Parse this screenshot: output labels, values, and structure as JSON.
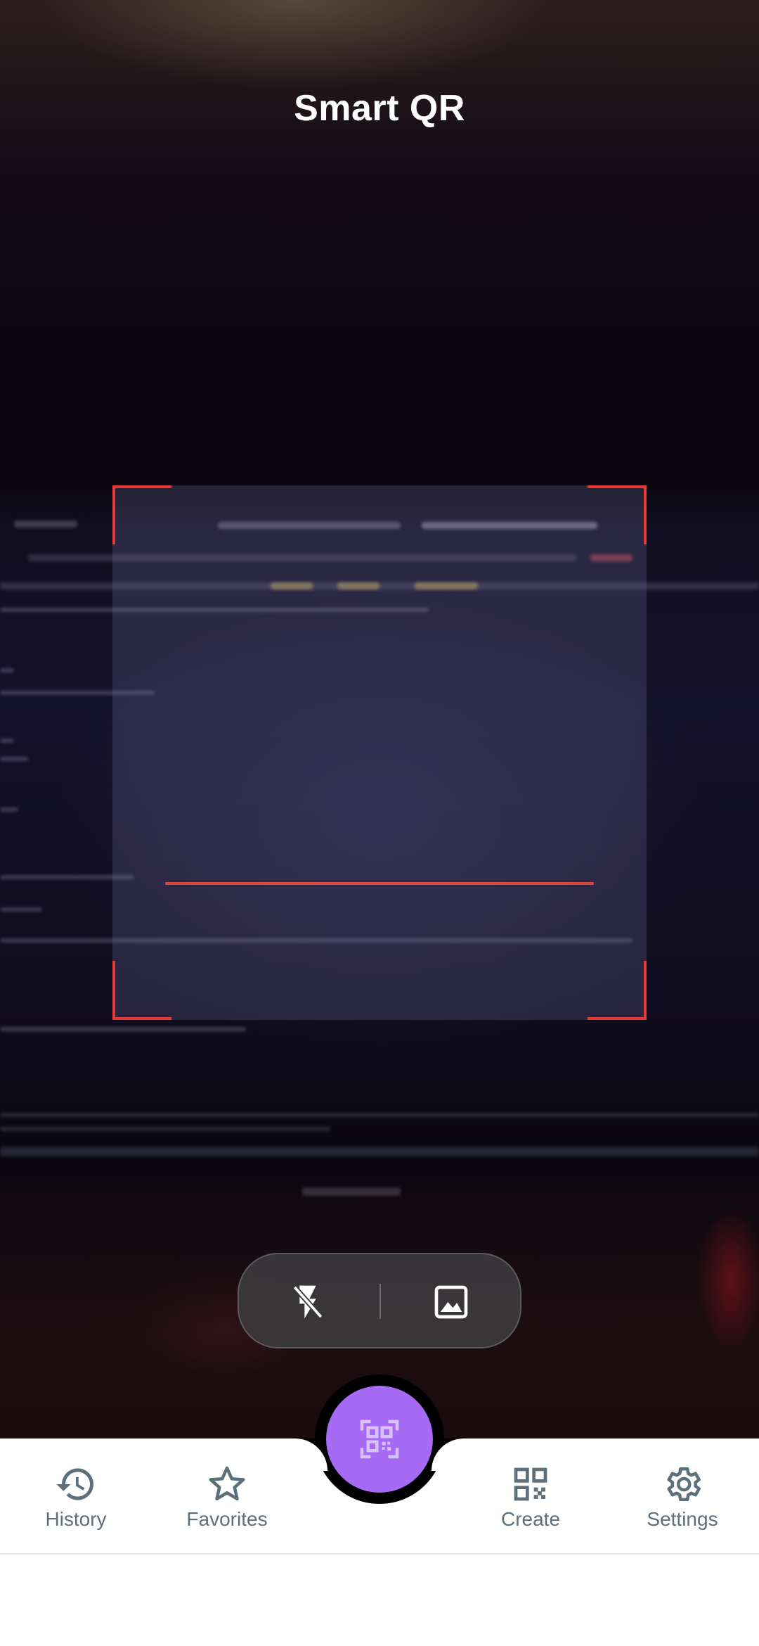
{
  "header": {
    "title": "Smart QR"
  },
  "scanner": {
    "corner_color": "#e53935",
    "scan_line_color": "#d9453f"
  },
  "controls": {
    "flash_icon": "flash-off-icon",
    "gallery_icon": "image-icon"
  },
  "fab": {
    "icon": "qr-scan-icon",
    "color": "#a66af5"
  },
  "bottom_nav": {
    "items": [
      {
        "label": "History",
        "icon": "history-icon"
      },
      {
        "label": "Favorites",
        "icon": "star-icon"
      },
      {
        "label": "Create",
        "icon": "qr-code-icon"
      },
      {
        "label": "Settings",
        "icon": "gear-icon"
      }
    ],
    "label_color": "#5c6f7a"
  }
}
